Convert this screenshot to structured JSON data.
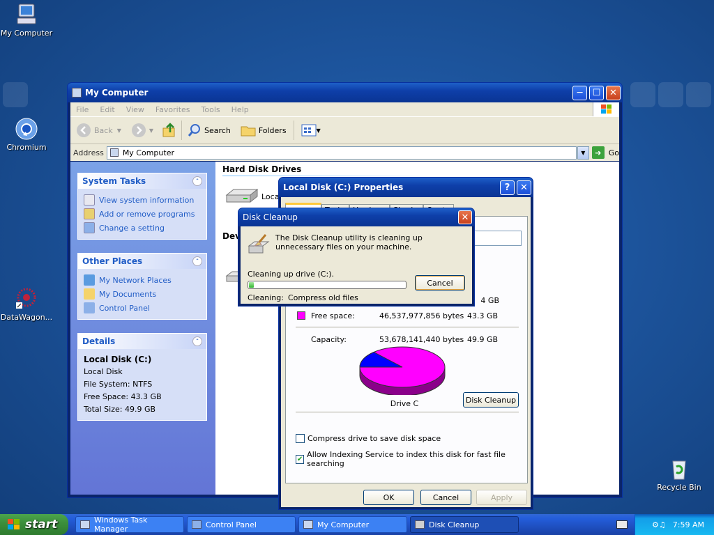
{
  "desktop": {
    "icons": [
      {
        "label": "My Computer"
      },
      {
        "label": "Chromium"
      },
      {
        "label": "DataWagon..."
      },
      {
        "label": "Recycle Bin"
      }
    ]
  },
  "explorer": {
    "title": "My Computer",
    "menu": [
      "File",
      "Edit",
      "View",
      "Favorites",
      "Tools",
      "Help"
    ],
    "toolbar": {
      "back": "Back",
      "search": "Search",
      "folders": "Folders"
    },
    "address_label": "Address",
    "address_value": "My Computer",
    "go_label": "Go",
    "system_tasks": {
      "title": "System Tasks",
      "items": [
        "View system information",
        "Add or remove programs",
        "Change a setting"
      ]
    },
    "other_places": {
      "title": "Other Places",
      "items": [
        "My Network Places",
        "My Documents",
        "Control Panel"
      ]
    },
    "details": {
      "title": "Details",
      "name": "Local Disk (C:)",
      "type": "Local Disk",
      "fs": "File System: NTFS",
      "free": "Free Space: 43.3 GB",
      "total": "Total Size: 49.9 GB"
    },
    "section_hdd": "Hard Disk Drives",
    "drive_label": "Local",
    "section_dev": "Dev"
  },
  "properties": {
    "title": "Local Disk (C:) Properties",
    "help": "?",
    "tabs": [
      "General",
      "Tools",
      "Hardware",
      "Sharing",
      "Quota"
    ],
    "used_size_tail": "4 GB",
    "free_label": "Free space:",
    "free_bytes": "46,537,977,856 bytes",
    "free_gb": "43.3 GB",
    "capacity_label": "Capacity:",
    "capacity_bytes": "53,678,141,440 bytes",
    "capacity_gb": "49.9 GB",
    "drive_caption": "Drive C",
    "disk_cleanup_btn": "Disk Cleanup",
    "compress_label": "Compress drive to save disk space",
    "compress_checked": false,
    "index_label": "Allow Indexing Service to index this disk for fast file searching",
    "index_checked": true,
    "ok": "OK",
    "cancel": "Cancel",
    "apply": "Apply",
    "colors": {
      "used": "#0000ff",
      "free": "#ff00ff"
    },
    "used_fraction": 0.133
  },
  "cleanup": {
    "title": "Disk Cleanup",
    "message": "The Disk Cleanup utility is cleaning up unnecessary files on your machine.",
    "drive_text": "Cleaning up drive  (C:).",
    "cancel": "Cancel",
    "cleaning_label": "Cleaning:",
    "cleaning_value": "Compress old files",
    "progress_fraction": 0.03
  },
  "taskbar": {
    "start": "start",
    "tasks": [
      "Windows Task Manager",
      "Control Panel",
      "My Computer",
      "Disk Cleanup"
    ],
    "clock": "7:59 AM"
  }
}
